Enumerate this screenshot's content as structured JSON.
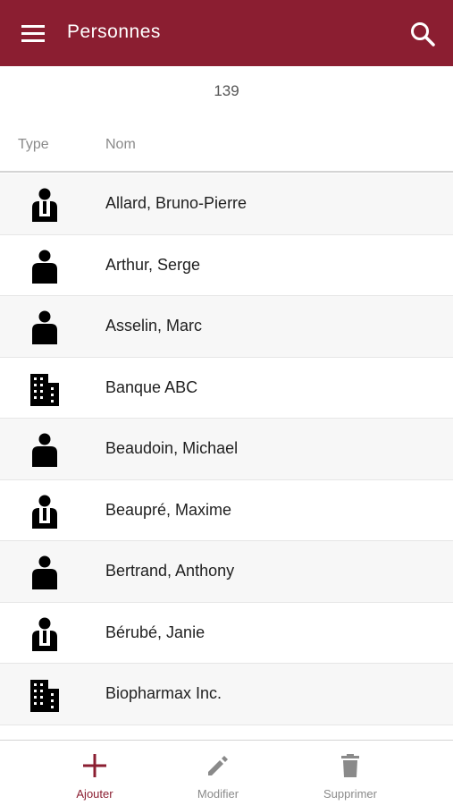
{
  "appbar": {
    "title": "Personnes",
    "menu_icon": "menu-icon",
    "search_icon": "search-icon",
    "color": "#8b1e31"
  },
  "count": "139",
  "columns": {
    "type": "Type",
    "name": "Nom"
  },
  "rows": [
    {
      "name": "Allard, Bruno-Pierre",
      "icon": "person-tie-icon"
    },
    {
      "name": "Arthur, Serge",
      "icon": "person-icon"
    },
    {
      "name": "Asselin, Marc",
      "icon": "person-icon"
    },
    {
      "name": "Banque ABC",
      "icon": "building-icon"
    },
    {
      "name": "Beaudoin, Michael",
      "icon": "person-icon"
    },
    {
      "name": "Beaupré, Maxime",
      "icon": "person-tie-icon"
    },
    {
      "name": "Bertrand, Anthony",
      "icon": "person-icon"
    },
    {
      "name": "Bérubé, Janie",
      "icon": "person-tie-icon"
    },
    {
      "name": "Biopharmax Inc.",
      "icon": "building-icon"
    }
  ],
  "bottom_nav": {
    "add_label": "Ajouter",
    "edit_label": "Modifier",
    "delete_label": "Supprimer",
    "active_color": "#8b1e31",
    "inactive_color": "#8a8a8a"
  }
}
